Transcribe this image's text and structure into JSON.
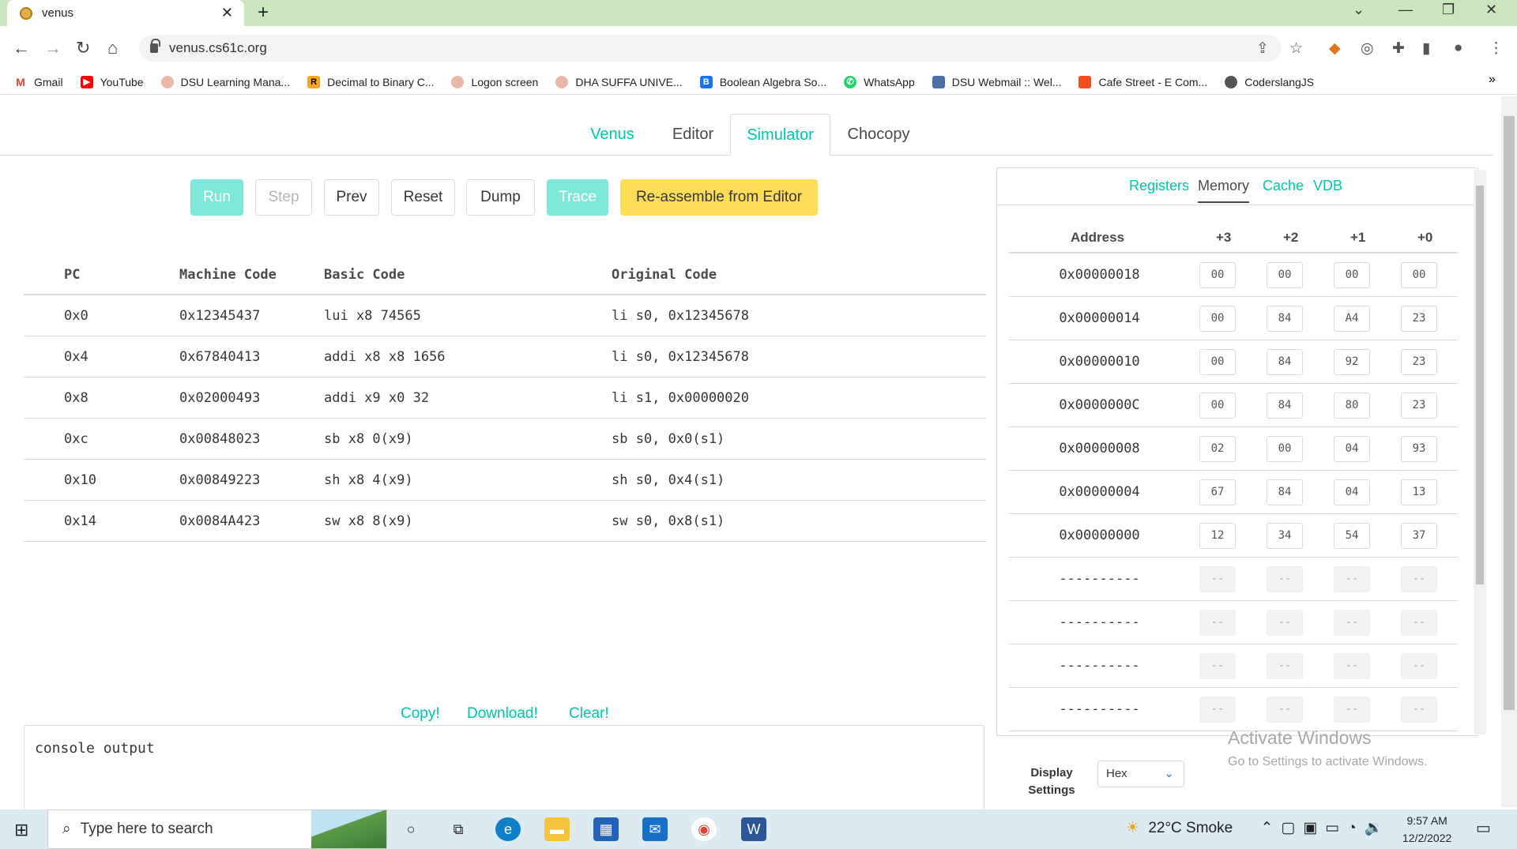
{
  "browser": {
    "tab_title": "venus",
    "url": "venus.cs61c.org",
    "bookmarks": [
      "Gmail",
      "YouTube",
      "DSU Learning Mana...",
      "Decimal to Binary C...",
      "Logon screen",
      "DHA SUFFA UNIVE...",
      "Boolean Algebra So...",
      "WhatsApp",
      "DSU Webmail :: Wel...",
      "Cafe Street - E Com...",
      "CoderslangJS"
    ],
    "more_bookmarks": "»"
  },
  "nav": {
    "venus": "Venus",
    "editor": "Editor",
    "simulator": "Simulator",
    "chocopy": "Chocopy"
  },
  "controls": {
    "run": "Run",
    "step": "Step",
    "prev": "Prev",
    "reset": "Reset",
    "dump": "Dump",
    "trace": "Trace",
    "reassemble": "Re-assemble from Editor"
  },
  "program": {
    "headers": {
      "pc": "PC",
      "machine": "Machine Code",
      "basic": "Basic Code",
      "original": "Original Code"
    },
    "rows": [
      {
        "pc": "0x0",
        "machine": "0x12345437",
        "basic": "lui x8 74565",
        "original": "li s0, 0x12345678"
      },
      {
        "pc": "0x4",
        "machine": "0x67840413",
        "basic": "addi x8 x8 1656",
        "original": "li s0, 0x12345678"
      },
      {
        "pc": "0x8",
        "machine": "0x02000493",
        "basic": "addi x9 x0 32",
        "original": "li s1, 0x00000020"
      },
      {
        "pc": "0xc",
        "machine": "0x00848023",
        "basic": "sb x8 0(x9)",
        "original": "sb s0, 0x0(s1)"
      },
      {
        "pc": "0x10",
        "machine": "0x00849223",
        "basic": "sh x8 4(x9)",
        "original": "sh s0, 0x4(s1)"
      },
      {
        "pc": "0x14",
        "machine": "0x0084A423",
        "basic": "sw x8 8(x9)",
        "original": "sw s0, 0x8(s1)"
      }
    ]
  },
  "console": {
    "copy": "Copy!",
    "download": "Download!",
    "clear": "Clear!",
    "output": "console output"
  },
  "panel": {
    "tabs": {
      "registers": "Registers",
      "memory": "Memory",
      "cache": "Cache",
      "vdb": "VDB"
    },
    "headers": {
      "address": "Address",
      "b3": "+3",
      "b2": "+2",
      "b1": "+1",
      "b0": "+0"
    },
    "rows": [
      {
        "addr": "0x00000018",
        "b": [
          "00",
          "00",
          "00",
          "00"
        ]
      },
      {
        "addr": "0x00000014",
        "b": [
          "00",
          "84",
          "A4",
          "23"
        ]
      },
      {
        "addr": "0x00000010",
        "b": [
          "00",
          "84",
          "92",
          "23"
        ]
      },
      {
        "addr": "0x0000000C",
        "b": [
          "00",
          "84",
          "80",
          "23"
        ]
      },
      {
        "addr": "0x00000008",
        "b": [
          "02",
          "00",
          "04",
          "93"
        ]
      },
      {
        "addr": "0x00000004",
        "b": [
          "67",
          "84",
          "04",
          "13"
        ]
      },
      {
        "addr": "0x00000000",
        "b": [
          "12",
          "34",
          "54",
          "37"
        ]
      },
      {
        "addr": "----------",
        "b": [
          "--",
          "--",
          "--",
          "--"
        ]
      },
      {
        "addr": "----------",
        "b": [
          "--",
          "--",
          "--",
          "--"
        ]
      },
      {
        "addr": "----------",
        "b": [
          "--",
          "--",
          "--",
          "--"
        ]
      },
      {
        "addr": "----------",
        "b": [
          "--",
          "--",
          "--",
          "--"
        ]
      }
    ],
    "display_label": "Display Settings",
    "display_value": "Hex"
  },
  "watermark": {
    "line1": "Activate Windows",
    "line2": "Go to Settings to activate Windows."
  },
  "taskbar": {
    "search": "Type here to search",
    "weather": "22°C  Smoke",
    "time": "9:57 AM",
    "date": "12/2/2022"
  }
}
